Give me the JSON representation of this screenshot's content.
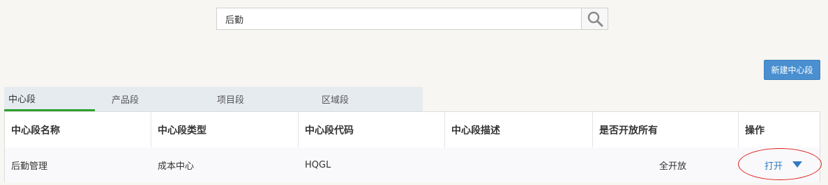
{
  "search": {
    "value": "后勤",
    "icon": "search-icon"
  },
  "toolbar": {
    "new_label": "新建中心段"
  },
  "tabs": [
    {
      "label": "中心段",
      "active": true
    },
    {
      "label": "产品段",
      "active": false
    },
    {
      "label": "项目段",
      "active": false
    },
    {
      "label": "区域段",
      "active": false
    }
  ],
  "table": {
    "columns": [
      "中心段名称",
      "中心段类型",
      "中心段代码",
      "中心段描述",
      "是否开放所有",
      "操作"
    ],
    "rows": [
      {
        "name": "后勤管理",
        "type": "成本中心",
        "code": "HQGL",
        "description": "",
        "open_all": "全开放",
        "action_label": "打开",
        "action_icon": "chevron-down-icon"
      }
    ]
  },
  "colors": {
    "accent": "#4a90d0",
    "active_tab_underline": "#2ea12e",
    "link": "#2f7ac0",
    "annotation": "#e0201c"
  }
}
